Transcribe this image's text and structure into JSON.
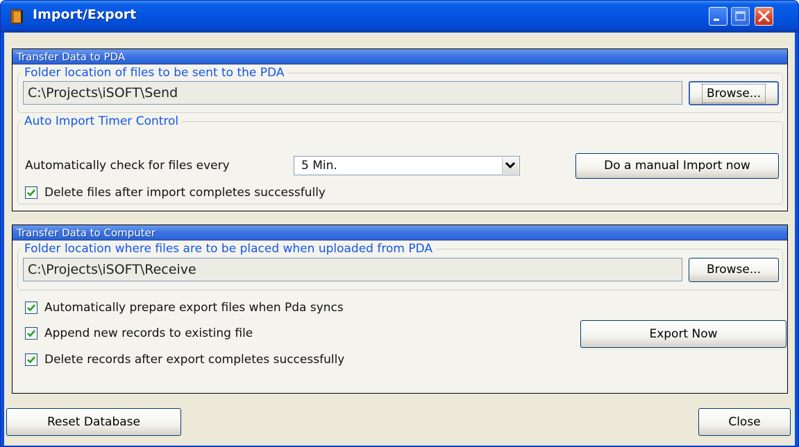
{
  "window": {
    "title": "Import/Export",
    "icon": "folder-book-icon"
  },
  "pda_section": {
    "header": "Transfer Data to PDA",
    "folder_group": {
      "legend": "Folder location of files to be sent to the PDA",
      "path": "C:\\Projects\\iSOFT\\Send",
      "browse_label": "Browse..."
    },
    "timer_group": {
      "legend": "Auto Import Timer Control",
      "check_label": "Automatically check for files every",
      "interval_value": "5 Min.",
      "manual_import_label": "Do a manual Import now",
      "delete_files_label": "Delete files after import completes successfully",
      "delete_files_checked": true
    }
  },
  "computer_section": {
    "header": "Transfer Data to Computer",
    "folder_group": {
      "legend": "Folder location where files are to be placed when uploaded from PDA",
      "path": "C:\\Projects\\iSOFT\\Receive",
      "browse_label": "Browse..."
    },
    "options": [
      {
        "label": "Automatically prepare export files when Pda syncs",
        "checked": true
      },
      {
        "label": "Append new records to existing file",
        "checked": true
      },
      {
        "label": "Delete records after export completes successfully",
        "checked": true
      }
    ],
    "export_now_label": "Export Now"
  },
  "footer": {
    "reset_label": "Reset Database",
    "close_label": "Close"
  },
  "colors": {
    "title_bar": "#0554e0",
    "section_header": "#3f76e2",
    "legend_text": "#1456e8",
    "check_mark": "#21a121",
    "close_button": "#d9432a"
  }
}
